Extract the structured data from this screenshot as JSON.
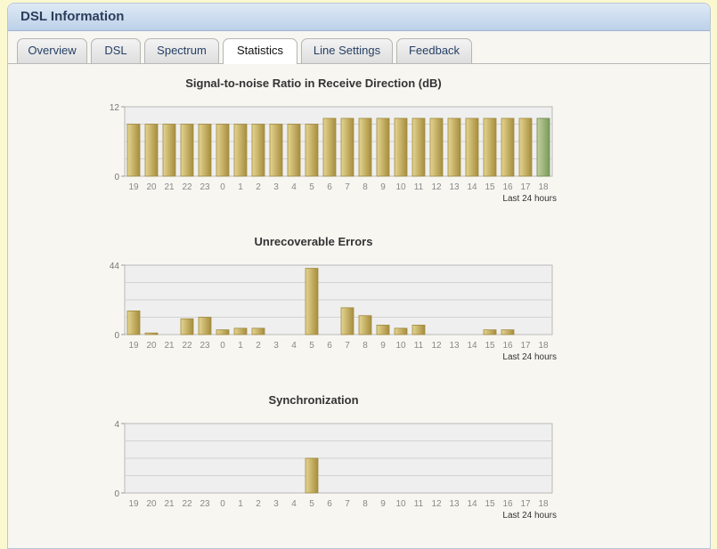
{
  "header": {
    "title": "DSL Information"
  },
  "tabs": [
    {
      "label": "Overview",
      "active": false
    },
    {
      "label": "DSL",
      "active": false
    },
    {
      "label": "Spectrum",
      "active": false
    },
    {
      "label": "Statistics",
      "active": true
    },
    {
      "label": "Line Settings",
      "active": false
    },
    {
      "label": "Feedback",
      "active": false
    }
  ],
  "colors": {
    "bar": "#d8c06a",
    "bar_highlight": "#9fbc7d",
    "plot_bg": "#efefef"
  },
  "chart_data": [
    {
      "type": "bar",
      "title": "Signal-to-noise Ratio in Receive Direction (dB)",
      "categories": [
        "19",
        "20",
        "21",
        "22",
        "23",
        "0",
        "1",
        "2",
        "3",
        "4",
        "5",
        "6",
        "7",
        "8",
        "9",
        "10",
        "11",
        "12",
        "13",
        "14",
        "15",
        "16",
        "17",
        "18"
      ],
      "values": [
        9,
        9,
        9,
        9,
        9,
        9,
        9,
        9,
        9,
        9,
        9,
        10,
        10,
        10,
        10,
        10,
        10,
        10,
        10,
        10,
        10,
        10,
        10,
        10
      ],
      "ylim": [
        0,
        12
      ],
      "yticks": [
        "12",
        "0"
      ],
      "xlabel": "Last 24 hours",
      "highlight_last": true,
      "grid": true
    },
    {
      "type": "bar",
      "title": "Unrecoverable Errors",
      "categories": [
        "19",
        "20",
        "21",
        "22",
        "23",
        "0",
        "1",
        "2",
        "3",
        "4",
        "5",
        "6",
        "7",
        "8",
        "9",
        "10",
        "11",
        "12",
        "13",
        "14",
        "15",
        "16",
        "17",
        "18"
      ],
      "values": [
        15,
        1,
        0,
        10,
        11,
        3,
        4,
        4,
        0,
        0,
        42,
        0,
        17,
        12,
        6,
        4,
        6,
        0,
        0,
        0,
        3,
        3,
        0,
        0
      ],
      "ylim": [
        0,
        44
      ],
      "yticks": [
        "44",
        "0"
      ],
      "xlabel": "Last 24 hours",
      "highlight_last": false,
      "grid": true
    },
    {
      "type": "bar",
      "title": "Synchronization",
      "categories": [
        "19",
        "20",
        "21",
        "22",
        "23",
        "0",
        "1",
        "2",
        "3",
        "4",
        "5",
        "6",
        "7",
        "8",
        "9",
        "10",
        "11",
        "12",
        "13",
        "14",
        "15",
        "16",
        "17",
        "18"
      ],
      "values": [
        0,
        0,
        0,
        0,
        0,
        0,
        0,
        0,
        0,
        0,
        2,
        0,
        0,
        0,
        0,
        0,
        0,
        0,
        0,
        0,
        0,
        0,
        0,
        0
      ],
      "ylim": [
        0,
        4
      ],
      "yticks": [
        "4",
        "0"
      ],
      "xlabel": "Last 24 hours",
      "highlight_last": false,
      "grid": true
    }
  ]
}
